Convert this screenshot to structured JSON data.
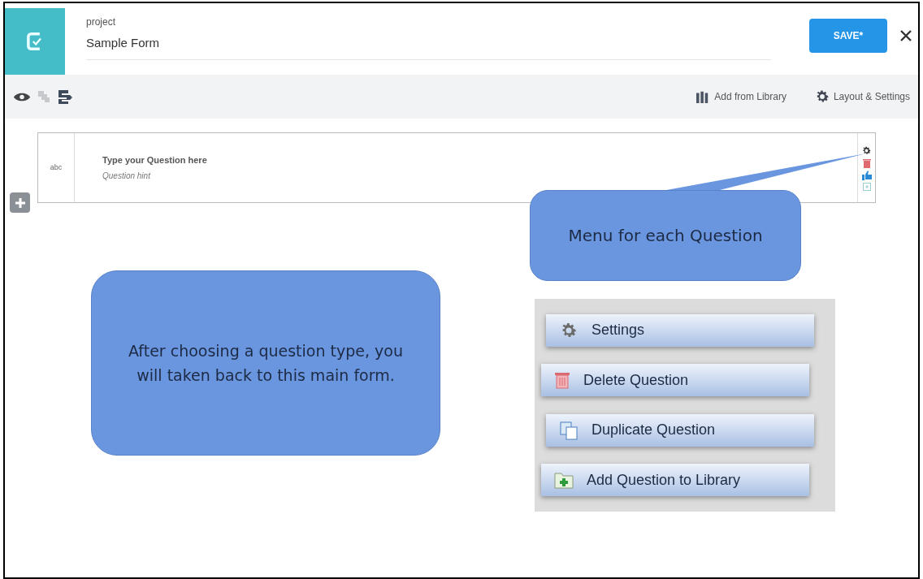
{
  "header": {
    "label": "project",
    "title": "Sample Form",
    "save_button": "SAVE*"
  },
  "toolbar": {
    "actions": [
      {
        "kind": "library",
        "label": "Add from Library"
      },
      {
        "kind": "settings",
        "label": "Layout & Settings"
      }
    ]
  },
  "question": {
    "type_label": "abc",
    "text": "Type your Question here",
    "hint": "Question hint"
  },
  "callouts": [
    {
      "text": "Menu for each Question"
    },
    {
      "text": "After choosing a question type, you will taken back to this main form."
    }
  ],
  "menu_items": [
    {
      "kind": "settings",
      "label": "Settings"
    },
    {
      "kind": "delete",
      "label": "Delete Question"
    },
    {
      "kind": "duplicate",
      "label": "Duplicate Question"
    },
    {
      "kind": "library",
      "label": "Add Question to Library"
    }
  ]
}
